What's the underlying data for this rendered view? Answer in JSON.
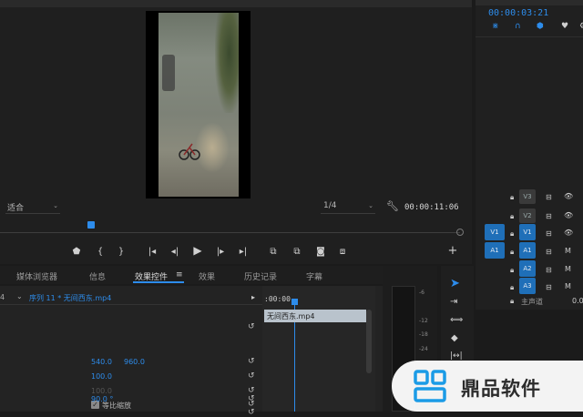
{
  "program_monitor": {
    "zoom_select": "适合",
    "resolution_select": "1/4",
    "timecode": "00:00:11:06"
  },
  "timeline_panel": {
    "timecode": "00:00:03:21",
    "tracks": {
      "video": [
        "V3",
        "V2",
        "V1"
      ],
      "audio": [
        "A1",
        "A2",
        "A3"
      ],
      "source_v": "V1",
      "source_a": "A1",
      "mute_label": "M",
      "master_label": "主声道",
      "master_value": "0.0"
    }
  },
  "bottom_tabs": {
    "items": [
      "媒体浏览器",
      "信息",
      "效果控件",
      "效果",
      "历史记录",
      "字幕"
    ],
    "active_index": 2
  },
  "effect_controls": {
    "sequence_left": "4",
    "sequence_label": "序列 11 * 无间西东.mp4",
    "time_ruler": ":00:00",
    "clip_label": "无间西东.mp4",
    "position_x": "540.0",
    "position_y": "960.0",
    "scale": "100.0",
    "scale_width": "100.0",
    "uniform_scale_label": "等比缩放",
    "rotation": "90.0 °"
  },
  "audio_meter": {
    "ticks": [
      "-6",
      "-12",
      "-18",
      "-24"
    ]
  },
  "watermark": {
    "text": "鼎品软件"
  },
  "colors": {
    "accent": "#2d8ceb",
    "track_active": "#1f6fb8",
    "panel": "#232323"
  }
}
